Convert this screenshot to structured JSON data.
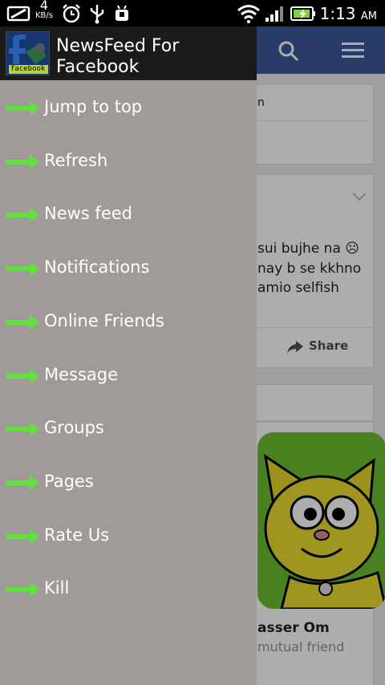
{
  "status_bar": {
    "network_speed_value": "4",
    "network_speed_unit": "KB/s",
    "time": "1:13",
    "ampm": "AM"
  },
  "drawer": {
    "title_line1": "NewsFeed For",
    "title_line2": "Facebook",
    "logo_text": "facebook",
    "items": [
      {
        "label": "Jump to top"
      },
      {
        "label": "Refresh"
      },
      {
        "label": "News feed"
      },
      {
        "label": "Notifications"
      },
      {
        "label": "Online Friends"
      },
      {
        "label": "Message"
      },
      {
        "label": "Groups"
      },
      {
        "label": "Pages"
      },
      {
        "label": "Rate Us"
      },
      {
        "label": "Kill"
      }
    ]
  },
  "background": {
    "card1_fragment": "n",
    "post_line1": "sui bujhe na ☹",
    "post_line2": "nay b se kkhno",
    "post_line3": "amio selfish",
    "share_label": "Share",
    "friend_name": "asser Om",
    "friend_subtitle": "mutual friend"
  },
  "colors": {
    "drawer_bg": "#a09b98",
    "header_bg": "#1b1b1b",
    "arrow_green": "#5ee33a",
    "facebook_blue": "#3b5998"
  }
}
